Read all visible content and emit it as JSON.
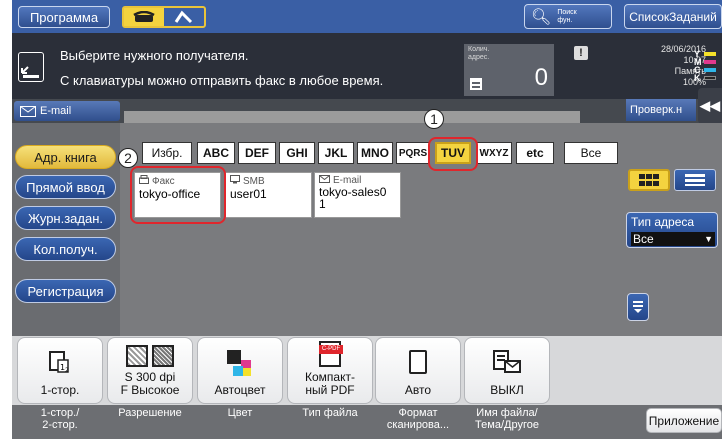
{
  "top": {
    "program_label": "Программа",
    "search_label_line1": "Поиск",
    "search_label_line2": "фун.",
    "job_list_label": "СписокЗаданий"
  },
  "info": {
    "message1": "Выберите нужного получателя.",
    "message2": "С клавиатуры можно отправить факс в любое время.",
    "count_label_line1": "Колич.",
    "count_label_line2": "адрес.",
    "count_value": "0",
    "date": "28/06/2016",
    "time": "10:07",
    "memory_label": "Память",
    "memory_value": "100%",
    "toner_letters": [
      "Y",
      "M",
      "C",
      "K"
    ],
    "toner_colors": [
      "#f4e12a",
      "#e0398e",
      "#2fb6e8",
      "#222222"
    ]
  },
  "strip": {
    "email_tab": "E-mail",
    "check_label": "Проверк.н"
  },
  "sidebar": {
    "items": [
      {
        "label": "Адр. книга",
        "active": true
      },
      {
        "label": "Прямой ввод"
      },
      {
        "label": "Журн.задан."
      },
      {
        "label": "Кол.получ."
      },
      {
        "label": "Регистрация"
      }
    ]
  },
  "tabs": [
    "Избр.",
    "ABC",
    "DEF",
    "GHI",
    "JKL",
    "MNO",
    "PQRS",
    "TUV",
    "WXYZ",
    "etc",
    "Все"
  ],
  "cards": [
    {
      "type": "Факс",
      "name": "tokyo-office"
    },
    {
      "type": "SMB",
      "name": "user01"
    },
    {
      "type": "E-mail",
      "name": "tokyo-sales0\n1"
    }
  ],
  "address_type": {
    "label": "Тип адреса",
    "value": "Все"
  },
  "callouts": [
    "1",
    "2"
  ],
  "functions": [
    {
      "value": "1-стор.",
      "label": "1-стор./\n2-стор."
    },
    {
      "value": "S 300 dpi\nF Высокое",
      "label": "Разрешение"
    },
    {
      "value": "Автоцвет",
      "label": "Цвет"
    },
    {
      "value": "Компакт-\nный PDF",
      "label": "Тип файла",
      "badge": "C-PDF"
    },
    {
      "value": "Авто",
      "label": "Формат\nсканирова..."
    },
    {
      "value": "ВЫКЛ",
      "label": "Имя файла/\nТема/Другое"
    }
  ],
  "application_label": "Приложение"
}
